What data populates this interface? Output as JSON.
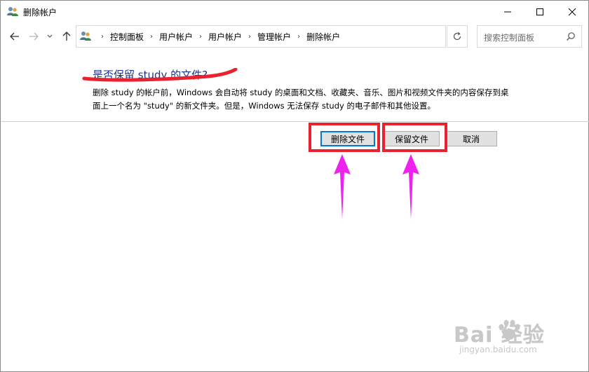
{
  "window": {
    "title": "删除帐户",
    "minimize_icon": "minimize-icon",
    "maximize_icon": "maximize-icon",
    "close_icon": "close-icon"
  },
  "nav": {
    "breadcrumbs": [
      "控制面板",
      "用户帐户",
      "用户帐户",
      "管理帐户",
      "删除帐户"
    ],
    "breadcrumb_separator": "›",
    "search_placeholder": "搜索控制面板"
  },
  "content": {
    "heading": "是否保留 study 的文件?",
    "description": "删除 study 的帐户前，Windows 会自动将 study 的桌面和文档、收藏夹、音乐、图片和视频文件夹的内容保存到桌面上一个名为 \"study\" 的新文件夹。但是，Windows 无法保存 study 的电子邮件和其他设置。"
  },
  "buttons": {
    "delete_files": "删除文件",
    "keep_files": "保留文件",
    "cancel": "取消"
  },
  "annotations": {
    "highlight_color": "#e8232f",
    "arrow_color": "#ee22ee",
    "underline_color": "#e8232f"
  },
  "watermark": {
    "main": "Bai  经验",
    "sub": "jingyan.baidu.com"
  }
}
